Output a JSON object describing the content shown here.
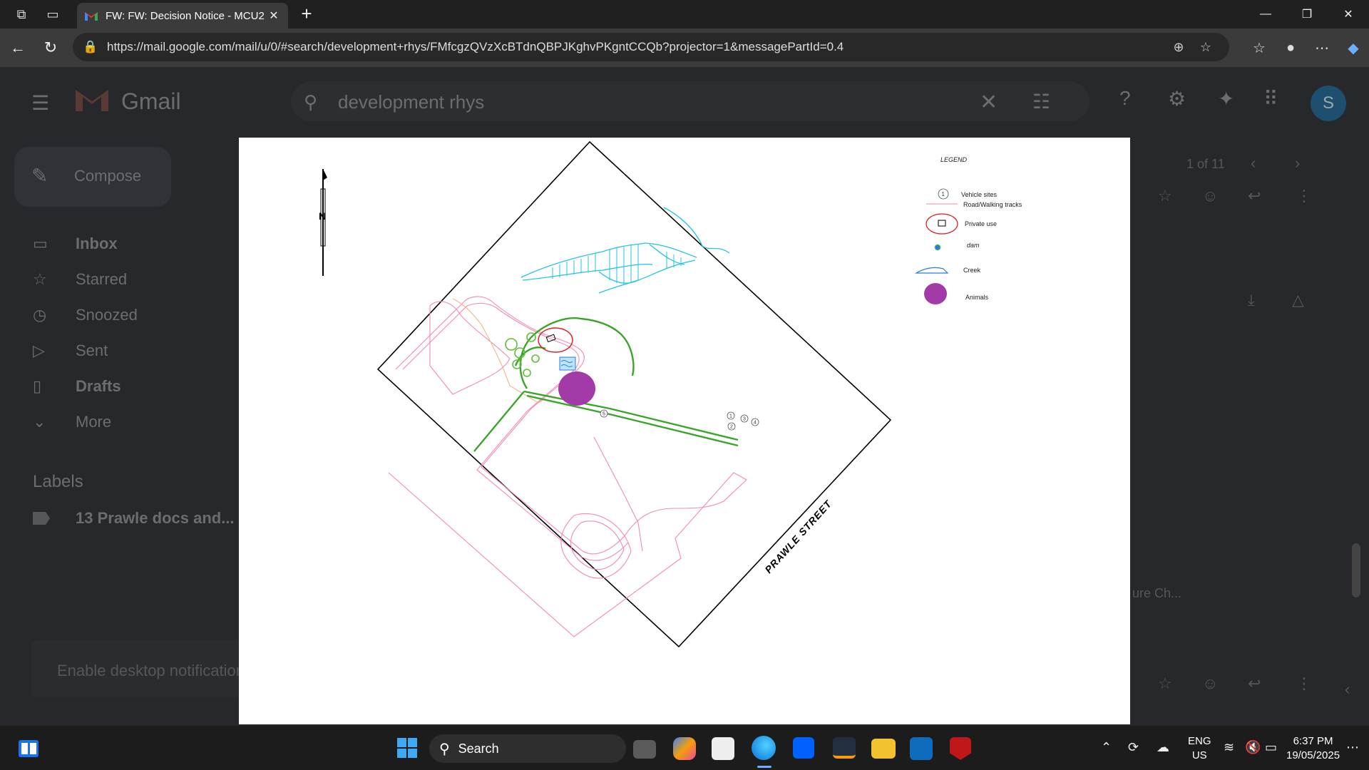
{
  "browser": {
    "tab_title": "FW: FW: Decision Notice - MCU2",
    "url": "https://mail.google.com/mail/u/0/#search/development+rhys/FMfcgzQVzXcBTdnQBPJKghvPKgntCCQb?projector=1&messagePartId=0.4"
  },
  "gmail": {
    "wordmark": "Gmail",
    "search_query": "development rhys",
    "avatar_letter": "S",
    "compose_label": "Compose",
    "nav": [
      {
        "label": "Inbox"
      },
      {
        "label": "Starred"
      },
      {
        "label": "Snoozed"
      },
      {
        "label": "Sent"
      },
      {
        "label": "Drafts"
      },
      {
        "label": "More"
      }
    ],
    "labels_heading": "Labels",
    "label_items": [
      {
        "label": "13 Prawle docs and..."
      }
    ],
    "notification": "Enable desktop notifications",
    "pagination": "1 of 11",
    "partial_text": "ure Ch..."
  },
  "map": {
    "north_label": "N",
    "street_label": "PRAWLE STREET",
    "legend_title": "LEGEND",
    "legend": [
      {
        "label": "Vehicle sites",
        "symbol": "1"
      },
      {
        "label": "Road/Walking tracks"
      },
      {
        "label": "Private use"
      },
      {
        "label": "dam"
      },
      {
        "label": "Creek"
      },
      {
        "label": "Animals"
      }
    ],
    "site_numbers": [
      "1",
      "2",
      "3",
      "4",
      "5"
    ],
    "colors": {
      "boundary": "#000000",
      "creek": "#22c4e0",
      "tracks": "#f28ab8",
      "vegetation": "#3aa52a",
      "private_use": "#e01e1e",
      "animals": "#a23ba8",
      "dam": "#2a7fd4"
    }
  },
  "taskbar": {
    "search_label": "Search",
    "lang_top": "ENG",
    "lang_bottom": "US",
    "time": "6:37 PM",
    "date": "19/05/2025"
  }
}
